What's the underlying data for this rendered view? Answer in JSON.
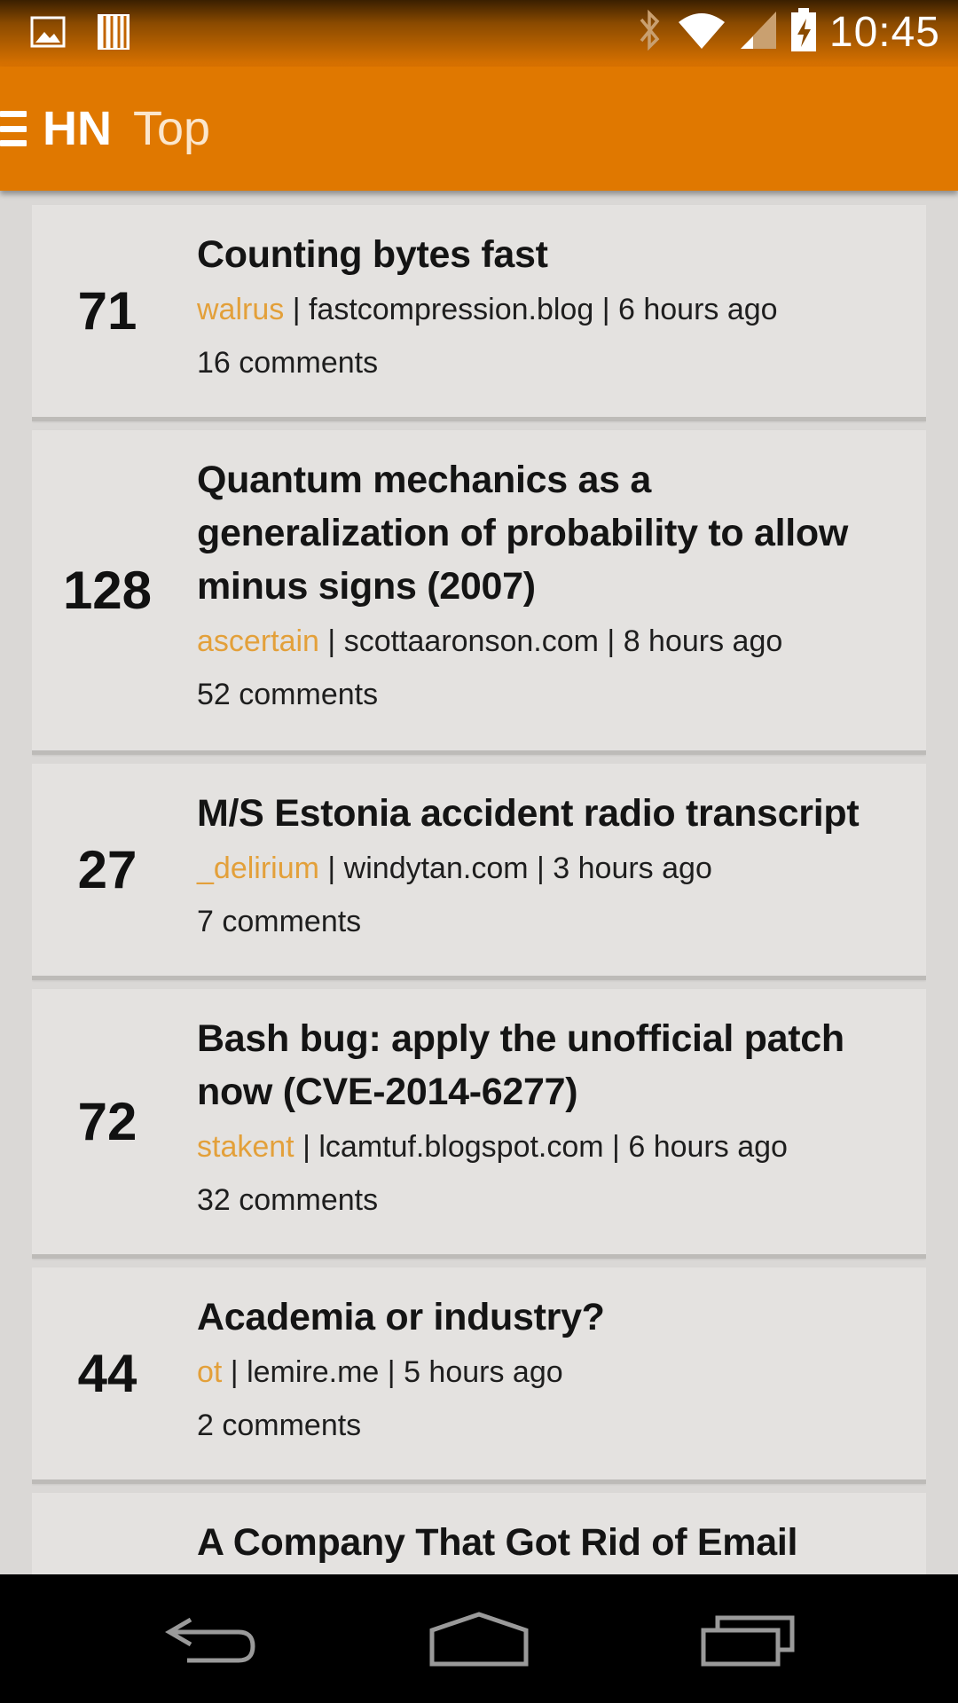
{
  "status_bar": {
    "time": "10:45",
    "icons": [
      "image-icon",
      "storage-icon",
      "bluetooth-icon",
      "wifi-icon",
      "signal-icon",
      "battery-charging-icon"
    ]
  },
  "app_bar": {
    "menu_icon": "hamburger-icon",
    "logo": "HN",
    "title": "Top"
  },
  "stories": [
    {
      "score": "71",
      "title": "Counting bytes fast",
      "user": "walrus",
      "domain": " | fastcompression.blog | ",
      "age": "6 hours ago",
      "comments": "16 comments"
    },
    {
      "score": "128",
      "title": "Quantum mechanics as a generalization of probability to allow minus signs (2007)",
      "user": "ascertain",
      "domain": " | scottaaronson.com | ",
      "age": "8 hours ago",
      "comments": "52 comments"
    },
    {
      "score": "27",
      "title": "M/S Estonia accident radio transcript",
      "user": "_delirium",
      "domain": " | windytan.com | ",
      "age": "3 hours ago",
      "comments": "7 comments"
    },
    {
      "score": "72",
      "title": "Bash bug: apply the unofficial patch now (CVE-2014-6277)",
      "user": "stakent",
      "domain": " | lcamtuf.blogspot.com | ",
      "age": "6 hours ago",
      "comments": "32 comments"
    },
    {
      "score": "44",
      "title": "Academia or industry?",
      "user": "ot",
      "domain": " | lemire.me | ",
      "age": "5 hours ago",
      "comments": "2 comments"
    },
    {
      "score": "",
      "title": "A Company That Got Rid of Email",
      "user": "",
      "domain": "",
      "age": "",
      "comments": ""
    }
  ],
  "nav_bar": {
    "buttons": [
      "back-icon",
      "home-icon",
      "recents-icon"
    ]
  },
  "colors": {
    "app_bar": "#e07800",
    "username": "#e3a03a",
    "card": "#e4e2e0",
    "background": "#dad8d6"
  }
}
